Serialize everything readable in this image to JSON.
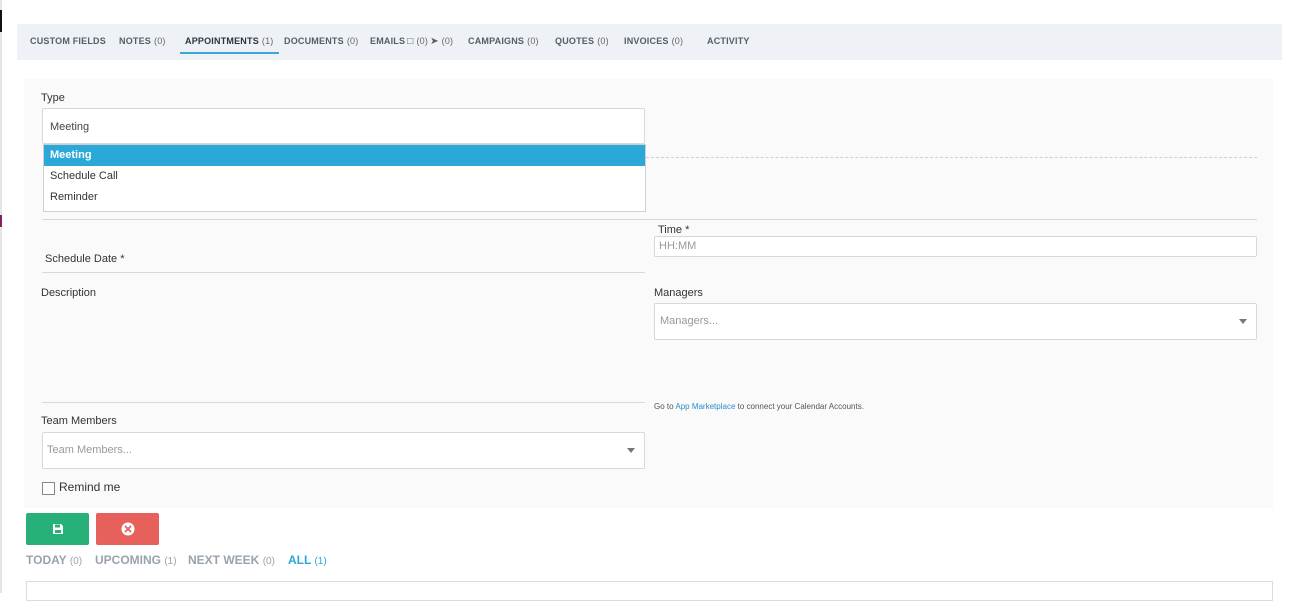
{
  "tabs": [
    {
      "label": "CUSTOM FIELDS",
      "count": ""
    },
    {
      "label": "NOTES",
      "count": "(0)"
    },
    {
      "label": "APPOINTMENTS",
      "count": "(1)"
    },
    {
      "label": "DOCUMENTS",
      "count": "(0)"
    },
    {
      "label": "EMAILS",
      "count": "(0)"
    },
    {
      "label": "",
      "count": "(0)"
    },
    {
      "label": "CAMPAIGNS",
      "count": "(0)"
    },
    {
      "label": "QUOTES",
      "count": "(0)"
    },
    {
      "label": "INVOICES",
      "count": "(0)"
    },
    {
      "label": "ACTIVITY",
      "count": ""
    }
  ],
  "form": {
    "type_label": "Type",
    "type_value": "Meeting",
    "type_options": [
      "Meeting",
      "Schedule Call",
      "Reminder"
    ],
    "time_label": "Time *",
    "time_placeholder": "HH:MM",
    "schedule_date_label": "Schedule Date *",
    "description_label": "Description",
    "managers_label": "Managers",
    "managers_placeholder": "Managers...",
    "calendar_note_prefix": "Go to",
    "calendar_note_link": "App Marketplace",
    "calendar_note_suffix": "to connect your Calendar Accounts.",
    "team_members_label": "Team Members",
    "team_members_placeholder": "Team Members...",
    "remind_me_label": "Remind me"
  },
  "filters": [
    {
      "label": "TODAY",
      "count": "(0)"
    },
    {
      "label": "UPCOMING",
      "count": "(1)"
    },
    {
      "label": "NEXT WEEK",
      "count": "(0)"
    },
    {
      "label": "ALL",
      "count": "(1)"
    }
  ],
  "colors": {
    "accent": "#2aa9d8",
    "save": "#27b178",
    "cancel": "#e8605c"
  }
}
